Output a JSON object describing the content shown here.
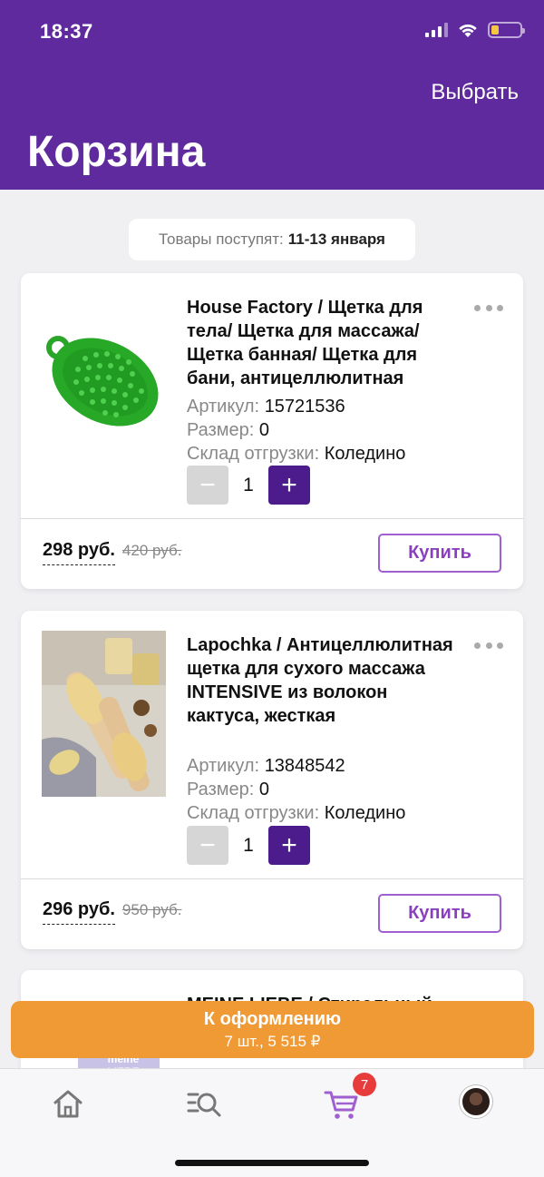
{
  "status_bar": {
    "time": "18:37"
  },
  "header": {
    "select_label": "Выбрать",
    "title": "Корзина"
  },
  "delivery": {
    "prefix": "Товары поступят:",
    "dates": "11-13 января"
  },
  "products": [
    {
      "title": "House Factory / Щетка для тела/ Щетка для массажа/ Щетка банная/ Щетка для бани, антицеллюлитная",
      "sku_label": "Артикул:",
      "sku": "15721536",
      "size_label": "Размер:",
      "size": "0",
      "warehouse_label": "Склад отгрузки:",
      "warehouse": "Коледино",
      "quantity": "1",
      "price": "298 руб.",
      "old_price": "420 руб.",
      "buy_label": "Купить"
    },
    {
      "title": "Lapochka / Антицеллюлитная щетка для сухого массажа INTENSIVE из волокон кактуса, жесткая",
      "sku_label": "Артикул:",
      "sku": "13848542",
      "size_label": "Размер:",
      "size": "0",
      "warehouse_label": "Склад отгрузки:",
      "warehouse": "Коледино",
      "quantity": "1",
      "price": "296 руб.",
      "old_price": "950 руб.",
      "buy_label": "Купить"
    },
    {
      "title": "MEINE LIEBE / Стиральный"
    }
  ],
  "checkout": {
    "label": "К оформлению",
    "summary": "7 шт., 5 515 ₽"
  },
  "tabbar": {
    "cart_badge": "7"
  },
  "colors": {
    "brand": "#5f2a9e",
    "accent_orange": "#f09a35",
    "plus_button": "#4d1c8c",
    "badge": "#e83b3b"
  }
}
